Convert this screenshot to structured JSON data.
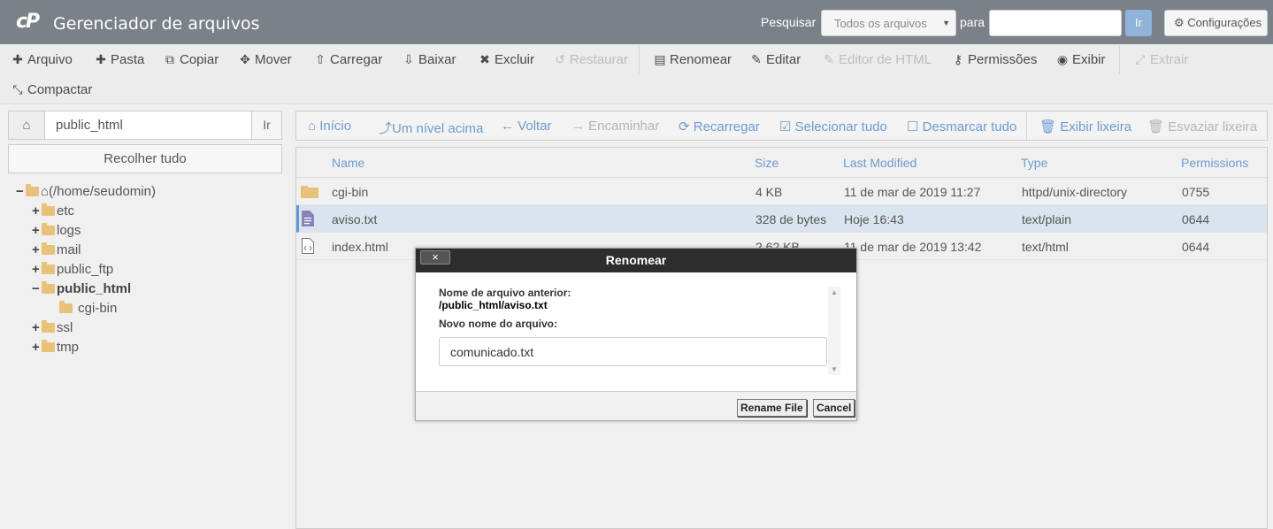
{
  "header": {
    "logo_text": "cP",
    "title": "Gerenciador de arquivos",
    "search_label": "Pesquisar",
    "search_scope": "Todos os arquivos",
    "for_label": "para",
    "search_value": "",
    "go_label": "Ir",
    "settings_label": "Configurações"
  },
  "toolbar": {
    "items": [
      {
        "label": "Arquivo",
        "icon": "plus-icon"
      },
      {
        "label": "Pasta",
        "icon": "plus-icon"
      },
      {
        "label": "Copiar",
        "icon": "copy-icon"
      },
      {
        "label": "Mover",
        "icon": "move-icon"
      },
      {
        "label": "Carregar",
        "icon": "upload-icon"
      },
      {
        "label": "Baixar",
        "icon": "download-icon"
      },
      {
        "label": "Excluir",
        "icon": "close-icon"
      },
      {
        "label": "Restaurar",
        "icon": "undo-icon"
      },
      {
        "label": "Renomear",
        "icon": "file-icon"
      },
      {
        "label": "Editar",
        "icon": "pencil-icon"
      },
      {
        "label": "Editor de HTML",
        "icon": "edit-icon"
      },
      {
        "label": "Permissões",
        "icon": "key-icon"
      },
      {
        "label": "Exibir",
        "icon": "eye-icon"
      },
      {
        "label": "Extrair",
        "icon": "expand-icon"
      },
      {
        "label": "Compactar",
        "icon": "compress-icon"
      }
    ]
  },
  "left": {
    "path": "public_html",
    "go_label": "Ir",
    "collapse_label": "Recolher tudo",
    "tree": [
      {
        "label": "(/home/seudomin)",
        "toggle": "−"
      },
      {
        "label": "etc",
        "toggle": "+"
      },
      {
        "label": "logs",
        "toggle": "+"
      },
      {
        "label": "mail",
        "toggle": "+"
      },
      {
        "label": "public_ftp",
        "toggle": "+"
      },
      {
        "label": "public_html",
        "toggle": "−"
      },
      {
        "label": "cgi-bin",
        "toggle": ""
      },
      {
        "label": "ssl",
        "toggle": "+"
      },
      {
        "label": "tmp",
        "toggle": "+"
      }
    ]
  },
  "nav": {
    "items": [
      {
        "label": "Início",
        "icon": "home-icon"
      },
      {
        "label": "Um nível acima",
        "icon": "level-up-icon"
      },
      {
        "label": "Voltar",
        "icon": "arrow-left-icon"
      },
      {
        "label": "Encaminhar",
        "icon": "arrow-right-icon"
      },
      {
        "label": "Recarregar",
        "icon": "refresh-icon"
      },
      {
        "label": "Selecionar tudo",
        "icon": "checkbox-checked-icon"
      },
      {
        "label": "Desmarcar tudo",
        "icon": "checkbox-empty-icon"
      },
      {
        "label": "Exibir lixeira",
        "icon": "trash-icon"
      },
      {
        "label": "Esvaziar lixeira",
        "icon": "trash-icon"
      }
    ]
  },
  "table": {
    "columns": [
      "Name",
      "Size",
      "Last Modified",
      "Type",
      "Permissions"
    ],
    "rows": [
      {
        "name": "cgi-bin",
        "size": "4 KB",
        "modified": "11 de mar de 2019 11:27",
        "type": "httpd/unix-directory",
        "perms": "0755",
        "icon": "folder-icon"
      },
      {
        "name": "aviso.txt",
        "size": "328 de bytes",
        "modified": "Hoje 16:43",
        "type": "text/plain",
        "perms": "0644",
        "icon": "text-file-icon"
      },
      {
        "name": "index.html",
        "size": "2.62 KB",
        "modified": "11 de mar de 2019 13:42",
        "type": "text/html",
        "perms": "0644",
        "icon": "code-file-icon"
      }
    ]
  },
  "dialog": {
    "close_label": "×",
    "title": "Renomear",
    "old_name_label": "Nome de arquivo anterior:",
    "old_path": "/public_html/aviso.txt",
    "new_name_label": "Novo nome do arquivo:",
    "new_name_value": "comunicado.txt",
    "rename_label": "Rename File",
    "cancel_label": "Cancel"
  },
  "colors": {
    "header_bg": "#7b8189",
    "link_blue": "#6f9bd0",
    "folder": "#e8c27a",
    "selected_row": "#d9e4ee",
    "dialog_title_bg": "#2d2d2d"
  }
}
